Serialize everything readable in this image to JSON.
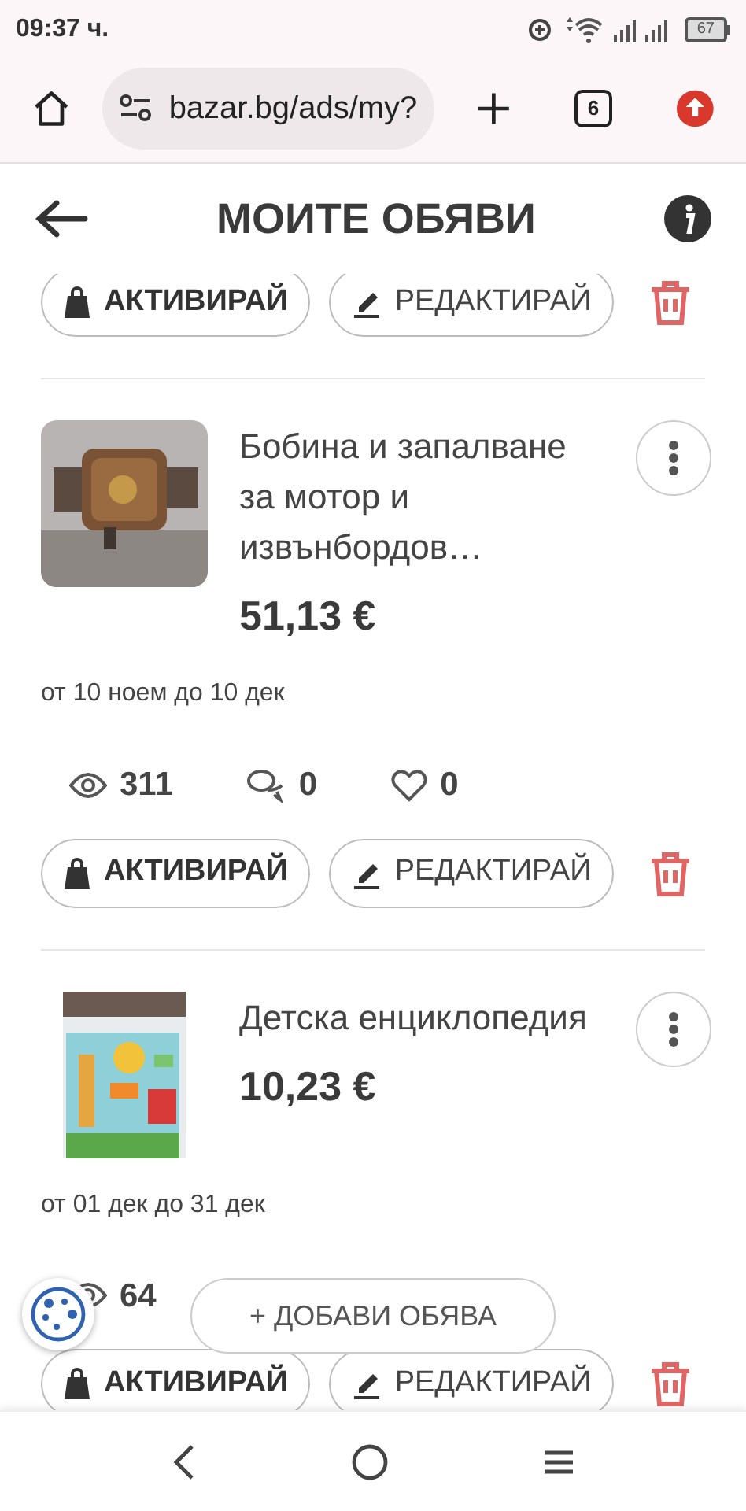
{
  "status_bar": {
    "time": "09:37 ч.",
    "battery": "67"
  },
  "browser": {
    "url": "bazar.bg/ads/my?",
    "tab_count": "6"
  },
  "header": {
    "title": "МОИТЕ ОБЯВИ"
  },
  "top_actions": {
    "activate": "АКТИВИРАЙ",
    "edit": "РЕДАКТИРАЙ"
  },
  "listings": [
    {
      "title": "Бобина и запалване за мотор и извънбордов…",
      "price": "51,13 €",
      "period": "от 10 ноем до 10 дек",
      "views": "311",
      "messages": "0",
      "favorites": "0",
      "activate": "АКТИВИРАЙ",
      "edit": "РЕДАКТИРАЙ"
    },
    {
      "title": "Детска енциклопедия",
      "price": "10,23 €",
      "period": "от 01 дек до 31 дек",
      "views": "64",
      "activate": "АКТИВИРАЙ",
      "edit": "РЕДАКТИРАЙ"
    }
  ],
  "add_button": {
    "label": "+ ДОБАВИ ОБЯВА"
  }
}
